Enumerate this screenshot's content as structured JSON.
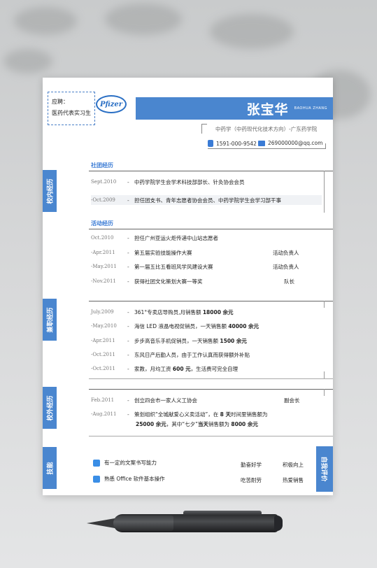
{
  "header": {
    "apply_label": "应聘：",
    "apply_position": "医药代表实习生",
    "logo_text": "Pfizer",
    "name": "张宝华",
    "name_pinyin": "BAOHUA  ZHANG",
    "major": "中药学（中药现代化技术方向）-广东药学院",
    "phone": "1591-000-9542",
    "email": "269000000@qq.com"
  },
  "side_tabs": [
    "校内经历",
    "兼职经历",
    "校外经历",
    "技能"
  ],
  "right_tab": "自我评价",
  "campus": {
    "club_title": "社团经历",
    "club_rows": [
      {
        "date": "Sept.2010",
        "desc": "中药学院学生会学术科技部部长、针灸协会会员"
      },
      {
        "date": "-Oct.2009",
        "desc": "担任团支书、青年志愿者协会会员、中药学院学生会学习部干事"
      }
    ],
    "activity_title": "活动经历",
    "activity_rows": [
      {
        "date": "Oct.2010",
        "desc": "担任广州亚运火炬传递中山站志愿者",
        "role": ""
      },
      {
        "date": "-Apr.2011",
        "desc": "第五届实验技能操作大赛",
        "role": "活动负责人"
      },
      {
        "date": "-May.2011",
        "desc": "第一届五比五看班风学风建设大赛",
        "role": "活动负责人"
      },
      {
        "date": "-Nov.2011",
        "desc": "获得社团文化策划大赛一等奖",
        "role": "队长"
      }
    ]
  },
  "parttime": [
    {
      "date": "July.2009",
      "pre": "361°专卖店导购员,月销售额 ",
      "bold": "18000 余元",
      "post": ""
    },
    {
      "date": "-May.2010",
      "pre": "海信 LED 液晶电视促销员，一天销售额 ",
      "bold": "40000 余元",
      "post": ""
    },
    {
      "date": "-Apr.2011",
      "pre": "步步高音乐手机促销员，一天销售额 ",
      "bold": "1500 余元",
      "post": ""
    },
    {
      "date": "-Oct.2011",
      "pre": "东风日产后勤人员，由于工作认真而获得额外补贴",
      "bold": "",
      "post": ""
    },
    {
      "date": "-Oct.2011",
      "pre": "家教，月均工资 ",
      "bold": "600 元",
      "post": "，生活费可完全自理"
    }
  ],
  "offcampus": {
    "row1": {
      "date": "Feb.2011",
      "desc": "创立四会市一家人义工协会",
      "role": "副会长"
    },
    "row2": {
      "date": "-Aug.2011",
      "line1_pre": "策划组织“全城献爱心义卖活动”，在 ",
      "line1_bold": "8 天",
      "line1_post": "时间里销售额为",
      "line2_bold1": "25000 余元",
      "line2_mid": "，其中“七夕”",
      "line2_bold2": "当天",
      "line2_mid2": "销售额为 ",
      "line2_bold3": "8000 余元"
    }
  },
  "skills": {
    "items": [
      "有一定的文案书写能力",
      "熟悉 Office 软件基本操作"
    ],
    "traits": [
      "勤奋好学",
      "积极向上",
      "吃苦耐劳",
      "热爱销售"
    ]
  },
  "colors": {
    "accent": "#4a86cf",
    "title_blue": "#3a7bd5"
  }
}
